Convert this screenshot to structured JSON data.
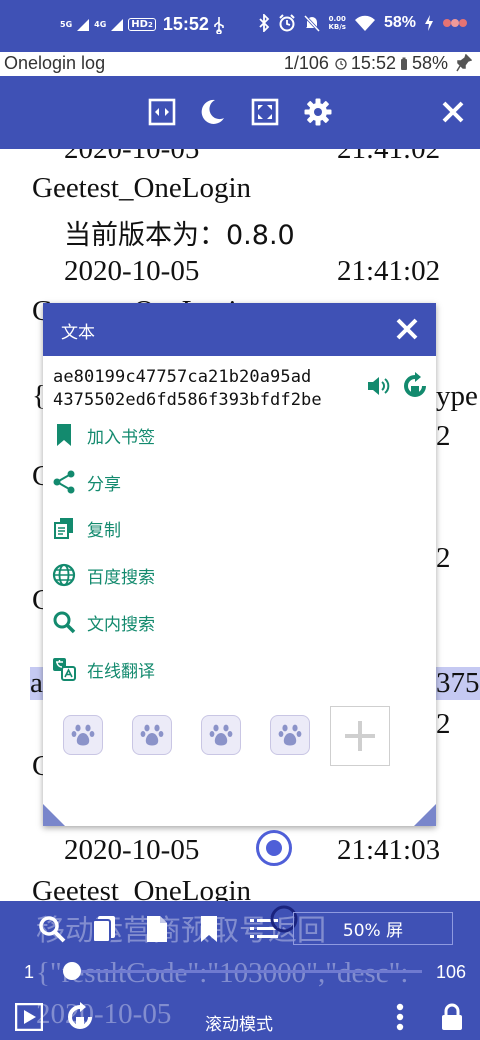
{
  "status_bar": {
    "signal_5g": "5G",
    "signal_4g": "4G",
    "hd_badge": "HD",
    "hd_sub": "2",
    "time": "15:52",
    "net_speed_value": "0.00",
    "net_speed_unit": "KB/s",
    "battery": "58%"
  },
  "title_bar": {
    "app_title": "Onelogin log",
    "page_info": "1/106",
    "clock": "15:52",
    "battery": "58%"
  },
  "content": {
    "lines": [
      {
        "text": "2020-10-05",
        "time": "21:41:02"
      },
      {
        "text": "Geetest_OneLogin"
      },
      {
        "text": "当前版本为：0.8.0"
      },
      {
        "text": "2020-10-05",
        "time": "21:41:02"
      },
      {
        "text": "Geetest_OneLogin"
      },
      {
        "text": "{",
        "tail": "ype"
      },
      {
        "text": "2"
      },
      {
        "text": "G"
      },
      {
        "text": "2"
      },
      {
        "text": "G"
      },
      {
        "text": "a",
        "tail": "375"
      },
      {
        "text": "2"
      },
      {
        "text": "G"
      },
      {
        "text": "2020-10-05",
        "time": "21:41:03"
      },
      {
        "text": "Geetest_OneLogin"
      }
    ]
  },
  "dialog": {
    "title": "文本",
    "selected_text_line1": "ae80199c47757ca21b20a95ad",
    "selected_text_line2": "4375502ed6fd586f393bfdf2be",
    "menu": [
      {
        "label": "加入书签",
        "icon": "bookmark-icon"
      },
      {
        "label": "分享",
        "icon": "share-icon"
      },
      {
        "label": "复制",
        "icon": "copy-icon"
      },
      {
        "label": "百度搜索",
        "icon": "globe-icon"
      },
      {
        "label": "文内搜索",
        "icon": "search-icon"
      },
      {
        "label": "在线翻译",
        "icon": "translate-icon"
      }
    ]
  },
  "bottom_bar": {
    "zoom_label": "50% 屏",
    "page_start": "1",
    "page_end": "106",
    "behind_line0": "移动运营商预取号返回",
    "behind_line1": "{\"resultCode\":\"103000\",\"desc\":",
    "behind_line2": "2020-10-05",
    "mode_label": "滚动模式"
  },
  "colors": {
    "primary": "#3f51b5",
    "menu_text": "#138a6e",
    "highlight": "#c5c9f2"
  }
}
